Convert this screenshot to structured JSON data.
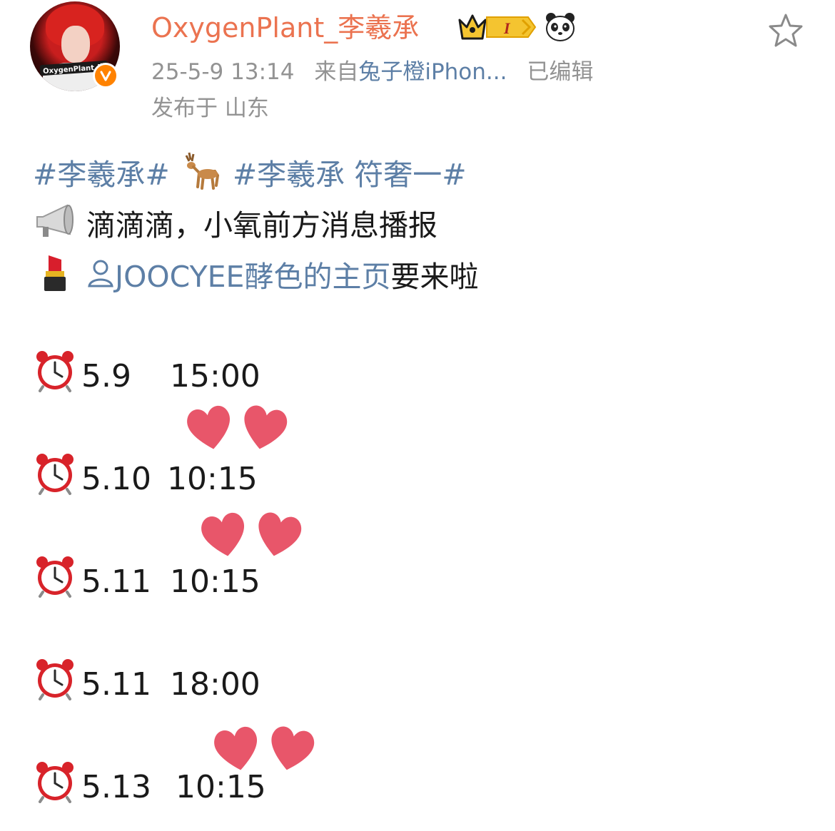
{
  "post": {
    "author": {
      "name": "OxygenPlant_李羲承",
      "avatar_caption": "OxygenPlant_李",
      "badge_level": "I",
      "verified_icon": "verified-v-icon"
    },
    "meta": {
      "time": "25-5-9 13:14",
      "from_prefix": "来自",
      "source": "兔子橙iPhon...",
      "edited": "已编辑",
      "location": "发布于 山东"
    },
    "content": {
      "topic1": "#李羲承#",
      "topic2": "#李羲承 符奢一#",
      "announce": "滴滴滴，小氧前方消息播报",
      "mention": "JOOCYEE酵色的主页",
      "mention_suffix": "要来啦",
      "schedule": [
        {
          "date": "5.9",
          "time": "15:00"
        },
        {
          "date": "5.10",
          "time": "10:15"
        },
        {
          "date": "5.11",
          "time": "10:15"
        },
        {
          "date": "5.11",
          "time": "18:00"
        },
        {
          "date": "5.13",
          "time": "10:15"
        }
      ]
    },
    "colors": {
      "username": "#eb7350",
      "link": "#5d7fa6",
      "meta": "#939393",
      "heart": "#e8566a"
    },
    "icons": [
      "crown-level-badge-icon",
      "panda-icon",
      "favorite-star-icon",
      "deer-emoji-icon",
      "megaphone-emoji-icon",
      "lipstick-emoji-icon",
      "user-mention-icon",
      "alarm-clock-emoji-icon",
      "heart-emoji-icon"
    ]
  }
}
